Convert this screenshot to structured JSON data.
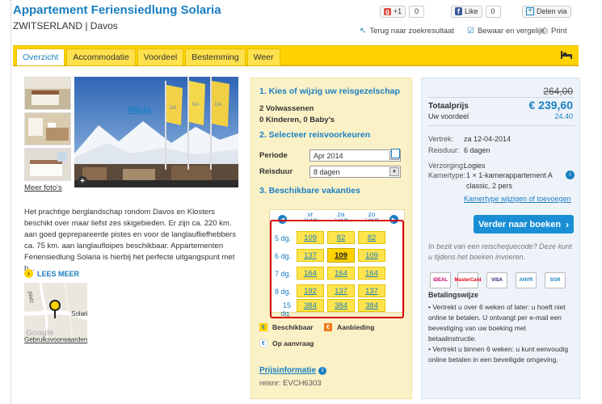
{
  "header": {
    "title": "Appartement Feriensiedlung Solaria",
    "subtitle": "ZWITSERLAND | Davos",
    "gplus_label": "+1",
    "gplus_count": "0",
    "fb_label": "Like",
    "fb_count": "0",
    "share_label": "Delen via",
    "back_label": "Terug naar zoekresultaat",
    "save_label": "Bewaar en vergelijk",
    "print_label": "Print"
  },
  "tabs": [
    "Overzicht",
    "Accommodatie",
    "Voordeel",
    "Bestemming",
    "Weer"
  ],
  "left": {
    "meer_fotos": "Meer foto's",
    "description": "Het prachtige berglandschap rondom Davos en Klosters beschikt over maar liefst zes skigebieden. Er zijn ca. 220 km. aan goed geprepareerde pistes en voor de langlaufliefhebbers ca. 75 km. aan langlaufloipes beschikbaar. Appartementen Feriensiedlung Solaria is hierbij het perfecte uitgangspunt met h...",
    "lees_meer": "LEES MEER",
    "map_label": "Solari",
    "map_road": "platz",
    "map_brand": "Google",
    "map_terms": "Gebruiksvoorwaarden"
  },
  "booking": {
    "step1": "1. Kies of wijzig uw reisgezelschap",
    "adults": "2 Volwassenen",
    "kids": "0 Kinderen, 0 Baby's",
    "wijzig": "Wijzig",
    "step2": "2. Selecteer reisvoorkeuren",
    "periode_label": "Periode",
    "periode_value": "Apr 2014",
    "reisduur_label": "Reisduur",
    "reisduur_value": "8 dagen",
    "step3": "3. Beschikbare vakanties",
    "columns": [
      "vr",
      "za",
      "zo"
    ],
    "column_dates": [
      "11-04",
      "12-04",
      "13-04"
    ],
    "rows": [
      {
        "label": "5 dg.",
        "prices": [
          "109",
          "82",
          "82"
        ]
      },
      {
        "label": "6 dg.",
        "prices": [
          "137",
          "109",
          "109"
        ]
      },
      {
        "label": "7 dg.",
        "prices": [
          "164",
          "164",
          "164"
        ]
      },
      {
        "label": "8 dg.",
        "prices": [
          "192",
          "137",
          "137"
        ]
      },
      {
        "label": "15 dg.",
        "prices": [
          "384",
          "384",
          "384"
        ]
      }
    ],
    "selected_cell": "109",
    "legend_beschikbaar": "Beschikbaar",
    "legend_aanbieding": "Aanbieding",
    "legend_aanvraag": "Op aanvraag",
    "prijsinformatie": "Prijsinformatie",
    "reisnr": "reisnr: EVCH6303"
  },
  "summary": {
    "old_price": "264,00",
    "total_label": "Totaalprijs",
    "total_value": "€ 239,60",
    "voordeel_label": "Uw voordeel",
    "voordeel_value": "24.40",
    "vertrek_label": "Vertrek:",
    "vertrek_value": "za 12-04-2014",
    "reisduur_label": "Reisduur:",
    "reisduur_value": "6 dagen",
    "verzorging_label": "Verzorging:",
    "verzorging_value": "Logies",
    "kamertype_label": "Kamertype:",
    "kamertype_value": "1 × 1-kamerappartement A classic, 2 pers",
    "kamertype_link": "Kamertype wijzigen of toevoegen",
    "book_button": "Verder naar boeken",
    "promo": "In bezit van een reischequecode? Deze kunt u tijdens het boeken invoeren.",
    "payment_logos": [
      "iDEAL",
      "MasterCard",
      "VISA",
      "ANVR",
      "SGR"
    ],
    "betaal_title": "Betalingswijze",
    "bullet1": "• Vertrekt u over 6 weken of later: u hoeft niet online te betalen. U ontvangt per e-mail een bevestiging van uw boeking met betaalinstructie.",
    "bullet2": "• Vertrekt u binnen 6 weken: u kunt eenvoudig online betalen in een beveiligde omgeving."
  },
  "colors": {
    "accent": "#1a7fc1",
    "tabbar": "#ffd200",
    "cell": "#ffe44d",
    "highlight": "#d8000c"
  }
}
